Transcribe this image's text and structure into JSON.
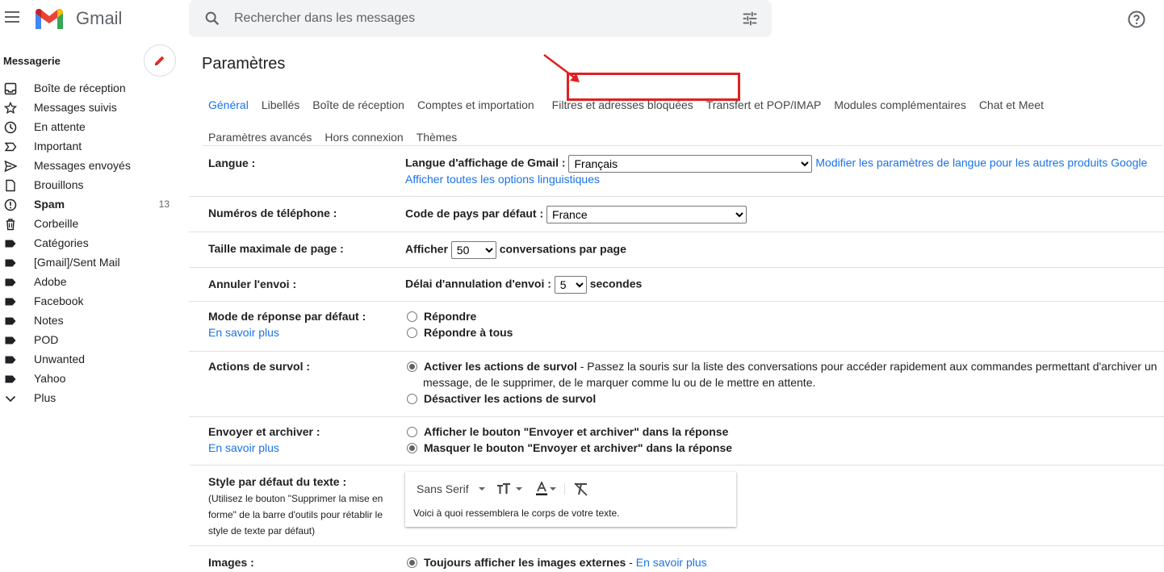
{
  "app": {
    "name": "Gmail"
  },
  "search": {
    "placeholder": "Rechercher dans les messages"
  },
  "sidebar": {
    "section_title": "Messagerie",
    "items": [
      {
        "label": "Boîte de réception",
        "icon": "inbox-icon"
      },
      {
        "label": "Messages suivis",
        "icon": "star-icon"
      },
      {
        "label": "En attente",
        "icon": "clock-icon"
      },
      {
        "label": "Important",
        "icon": "important-icon"
      },
      {
        "label": "Messages envoyés",
        "icon": "send-icon"
      },
      {
        "label": "Brouillons",
        "icon": "draft-icon"
      },
      {
        "label": "Spam",
        "icon": "spam-icon",
        "count": "13",
        "bold": true
      },
      {
        "label": "Corbeille",
        "icon": "trash-icon"
      },
      {
        "label": "Catégories",
        "icon": "label-icon"
      },
      {
        "label": "[Gmail]/Sent Mail",
        "icon": "label-icon"
      },
      {
        "label": "Adobe",
        "icon": "label-icon"
      },
      {
        "label": "Facebook",
        "icon": "label-icon"
      },
      {
        "label": "Notes",
        "icon": "label-icon"
      },
      {
        "label": "POD",
        "icon": "label-icon"
      },
      {
        "label": "Unwanted",
        "icon": "label-icon"
      },
      {
        "label": "Yahoo",
        "icon": "label-icon"
      },
      {
        "label": "Plus",
        "icon": "chevron-down-icon"
      }
    ]
  },
  "main": {
    "title": "Paramètres",
    "tabs_row1": [
      "Général",
      "Libellés",
      "Boîte de réception",
      "Comptes et importation",
      "Filtres et adresses bloquées",
      "Transfert et POP/IMAP",
      "Modules complémentaires",
      "Chat et Meet"
    ],
    "tabs_row2": [
      "Paramètres avancés",
      "Hors connexion",
      "Thèmes"
    ],
    "active_tab": "Général",
    "highlighted_tab": "Filtres et adresses bloquées"
  },
  "settings": {
    "langue": {
      "label": "Langue :",
      "display_label": "Langue d'affichage de Gmail :",
      "value": "Français",
      "link1": "Modifier les paramètres de langue pour les autres produits Google",
      "link2": "Afficher toutes les options linguistiques"
    },
    "phone": {
      "label": "Numéros de téléphone :",
      "country_label": "Code de pays par défaut :",
      "value": "France"
    },
    "page_size": {
      "label": "Taille maximale de page :",
      "prefix": "Afficher",
      "value": "50",
      "suffix": "conversations par page"
    },
    "undo": {
      "label": "Annuler l'envoi :",
      "prefix": "Délai d'annulation d'envoi :",
      "value": "5",
      "suffix": "secondes"
    },
    "reply": {
      "label": "Mode de réponse par défaut :",
      "learn_more": "En savoir plus",
      "option1": "Répondre",
      "option2": "Répondre à tous"
    },
    "hover": {
      "label": "Actions de survol :",
      "option1": "Activer les actions de survol",
      "option1_desc": " - Passez la souris sur la liste des conversations pour accéder rapidement aux commandes permettant d'archiver un",
      "option1_desc2": "message, de le supprimer, de le marquer comme lu ou de le mettre en attente.",
      "option2": "Désactiver les actions de survol"
    },
    "send_archive": {
      "label": "Envoyer et archiver :",
      "learn_more": "En savoir plus",
      "option1": "Afficher le bouton \"Envoyer et archiver\" dans la réponse",
      "option2": "Masquer le bouton \"Envoyer et archiver\" dans la réponse"
    },
    "text_style": {
      "label": "Style par défaut du texte :",
      "hint": "(Utilisez le bouton \"Supprimer la mise en forme\" de la barre d'outils pour rétablir le style de texte par défaut)",
      "font": "Sans Serif",
      "preview": "Voici à quoi ressemblera le corps de votre texte."
    },
    "images": {
      "label": "Images :",
      "option1": "Toujours afficher les images externes",
      "sep": " - ",
      "learn_more": "En savoir plus"
    }
  },
  "colors": {
    "accent": "#1a73e8",
    "highlight": "#e02020"
  }
}
